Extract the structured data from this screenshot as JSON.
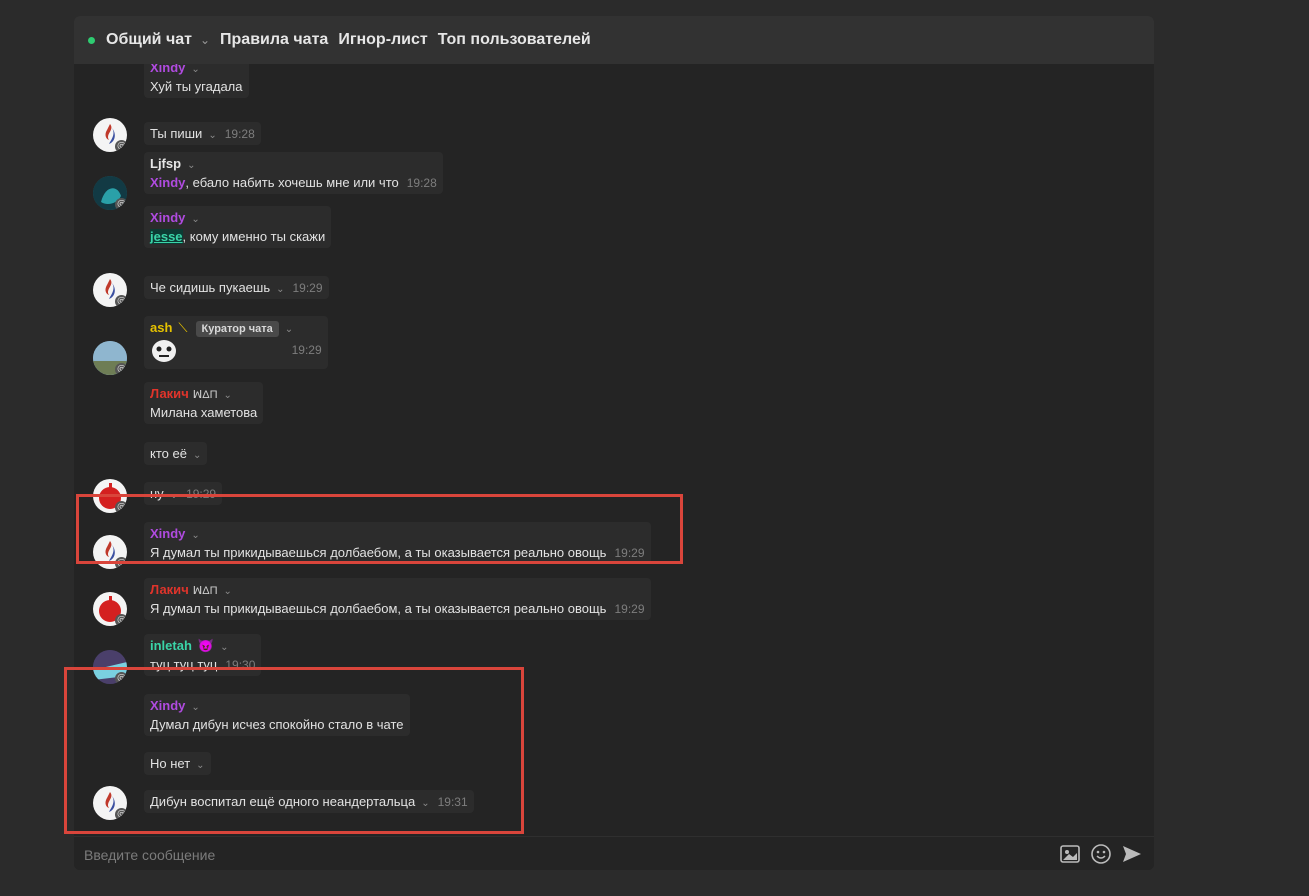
{
  "header": {
    "items": [
      "Общий чат",
      "Правила чата",
      "Игнор-лист",
      "Топ пользователей"
    ]
  },
  "messages": [
    {
      "author": "Xindy",
      "text": "Хуй ты угадала",
      "time": ""
    },
    {
      "text": "Ты пиши",
      "time": "19:28"
    },
    {
      "author": "Ljfsp",
      "mention": "Xindy",
      "text": ", ебало набить хочешь мне или что",
      "time": "19:28"
    },
    {
      "author": "Xindy",
      "mention": "jesse",
      "text": ", кому именно ты скажи",
      "time": ""
    },
    {
      "text": "Че сидишь пукаешь",
      "time": "19:29"
    },
    {
      "author": "ash",
      "badge": "Куратор чата",
      "time": "19:29"
    },
    {
      "author_a": "Лаки",
      "author_b": "ч",
      "author_tag": "ꟽΔΠ",
      "text": "Милана хаметова",
      "time": ""
    },
    {
      "text": "кто её",
      "time": ""
    },
    {
      "text": "ну",
      "time": "19:29"
    },
    {
      "author": "Xindy",
      "text": "Я думал ты прикидываешься долбаебом, а ты оказывается реально овощь",
      "time": "19:29"
    },
    {
      "author_a": "Лаки",
      "author_b": "ч",
      "author_tag": "ꟽΔΠ",
      "text": "Я думал ты прикидываешься долбаебом, а ты оказывается реально овощь",
      "time": "19:29"
    },
    {
      "author": "inletah",
      "text": "туц туц туц",
      "time": "19:30"
    },
    {
      "author": "Xindy",
      "text": "Думал дибун исчез спокойно стало в чате",
      "time": ""
    },
    {
      "text": "Но нет",
      "time": ""
    },
    {
      "text": "Дибун воспитал ещё одного неандертальца",
      "time": "19:31"
    }
  ],
  "footer": {
    "placeholder": "Введите сообщение"
  },
  "colors": {
    "purple": "#b04be0",
    "yellow": "#e6c200",
    "red": "#e0342b",
    "teal": "#3ad4a8",
    "highlight": "#d9453b"
  }
}
